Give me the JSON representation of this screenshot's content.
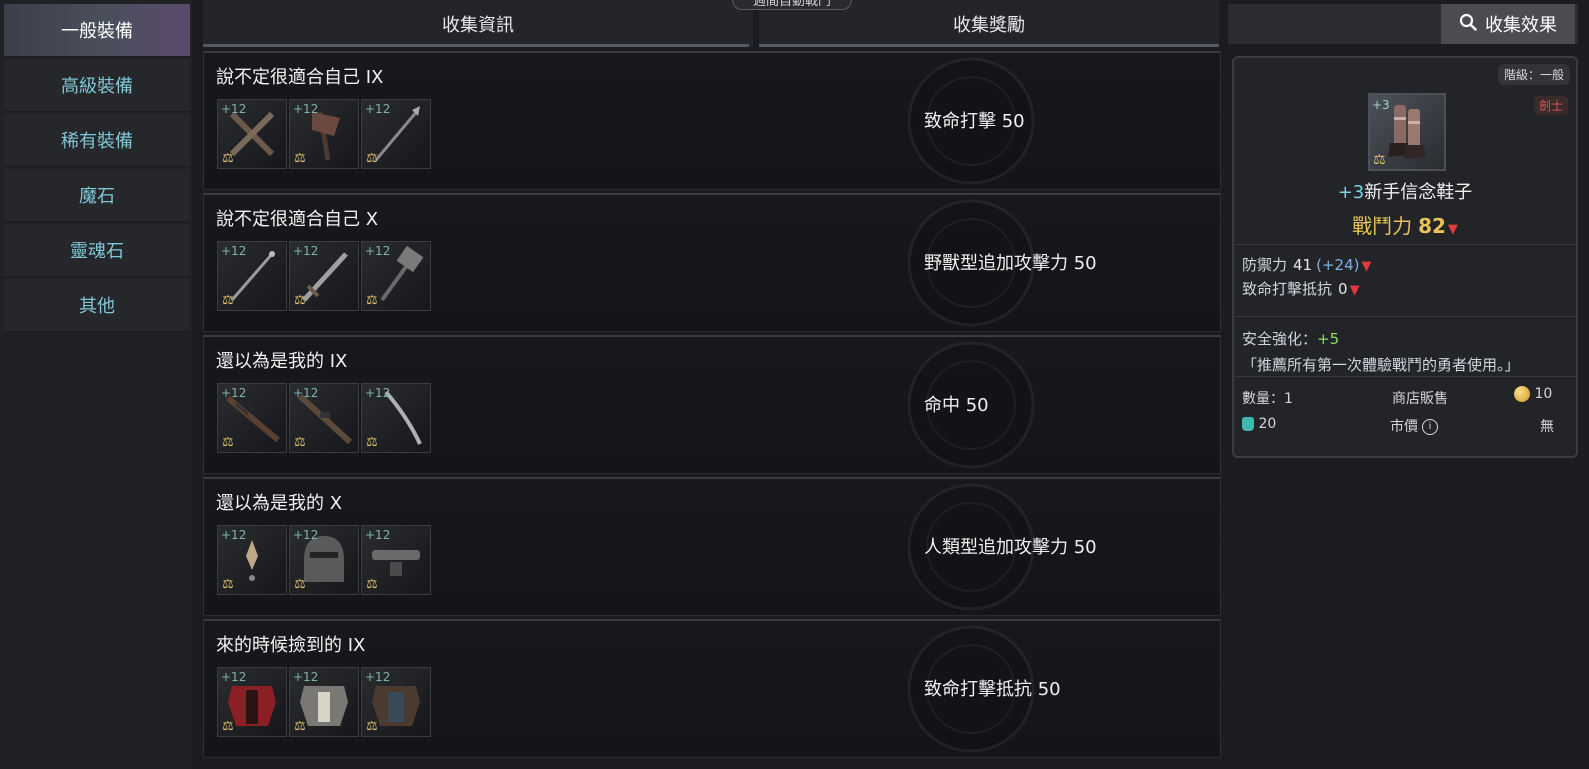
{
  "top_tab": {
    "label": "週間自動戰鬥"
  },
  "sidebar": {
    "items": [
      {
        "label": "一般裝備",
        "active": true
      },
      {
        "label": "高級裝備",
        "active": false
      },
      {
        "label": "稀有裝備",
        "active": false
      },
      {
        "label": "魔石",
        "active": false
      },
      {
        "label": "靈魂石",
        "active": false
      },
      {
        "label": "其他",
        "active": false
      }
    ]
  },
  "columns": {
    "info": "收集資訊",
    "reward": "收集獎勵"
  },
  "collections": [
    {
      "title": "說不定很適合自己 IX",
      "reward": "致命打擊 50",
      "items": [
        {
          "level": "+12",
          "icon": "crossed-pistols-icon"
        },
        {
          "level": "+12",
          "icon": "axe-icon"
        },
        {
          "level": "+12",
          "icon": "spear-icon"
        }
      ]
    },
    {
      "title": "說不定很適合自己 X",
      "reward": "野獸型追加攻擊力 50",
      "items": [
        {
          "level": "+12",
          "icon": "staff-icon"
        },
        {
          "level": "+12",
          "icon": "sword-icon"
        },
        {
          "level": "+12",
          "icon": "hammer-icon"
        }
      ]
    },
    {
      "title": "還以為是我的 IX",
      "reward": "命中 50",
      "items": [
        {
          "level": "+12",
          "icon": "rifle-icon"
        },
        {
          "level": "+12",
          "icon": "gun-icon"
        },
        {
          "level": "+12",
          "icon": "curved-blade-icon"
        }
      ]
    },
    {
      "title": "還以為是我的 X",
      "reward": "人類型追加攻擊力 50",
      "items": [
        {
          "level": "+12",
          "icon": "earring-icon"
        },
        {
          "level": "+12",
          "icon": "helmet-icon"
        },
        {
          "level": "+12",
          "icon": "belt-icon"
        }
      ]
    },
    {
      "title": "來的時候撿到的 IX",
      "reward": "致命打擊抵抗 50",
      "items": [
        {
          "level": "+12",
          "icon": "red-armor-icon"
        },
        {
          "level": "+12",
          "icon": "plate-armor-icon"
        },
        {
          "level": "+12",
          "icon": "leather-armor-icon"
        }
      ]
    }
  ],
  "right_panel": {
    "effect_button": "收集效果",
    "grade": "階級：一般",
    "class": "劍士",
    "item_level": "+3",
    "item_name_plus": "+3",
    "item_name": "新手信念鞋子",
    "power_label": "戰鬥力",
    "power_value": "82",
    "stats": [
      {
        "label": "防禦力",
        "value": "41",
        "bonus": "(+24)"
      },
      {
        "label": "致命打擊抵抗",
        "value": "0",
        "bonus": ""
      }
    ],
    "safe_enhance_label": "安全強化：",
    "safe_enhance_value": "+5",
    "description": "「推薦所有第一次體驗戰鬥的勇者使用。」",
    "quantity": "數量：1",
    "shop_sell_label": "商店販售",
    "shop_sell_value": "10",
    "weight_value": "20",
    "market_label": "市價",
    "market_value": "無"
  },
  "colors": {
    "accent_cyan": "#7fc6d6",
    "gold": "#e9c15b",
    "down_red": "#e03a3a"
  }
}
